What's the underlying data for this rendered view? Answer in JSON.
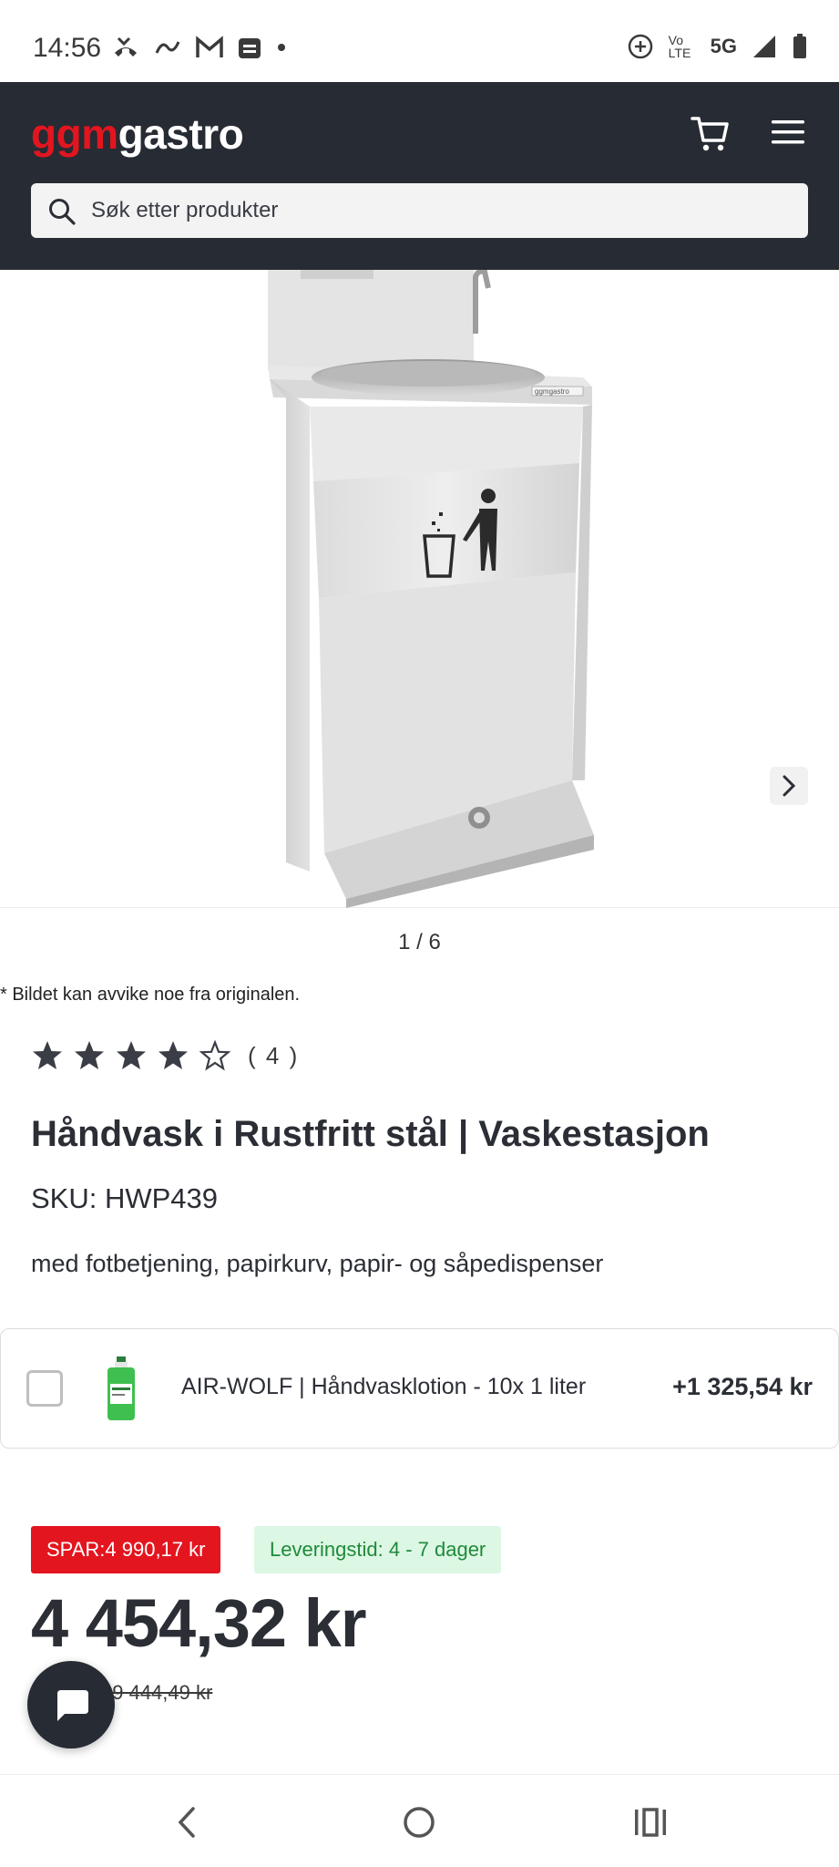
{
  "status_bar": {
    "time": "14:56",
    "left_icons": [
      "missed-call-icon",
      "link-icon",
      "gmail-icon",
      "news-icon",
      "dot-icon"
    ],
    "right_icons": [
      "data-saver-icon",
      "volte-icon",
      "5g-icon",
      "signal-icon",
      "battery-icon"
    ],
    "network_label": "5G",
    "volte_label": "Vo LTE"
  },
  "header": {
    "logo_ggm": "ggm",
    "logo_gastro": "gastro",
    "cart_icon": "cart-icon",
    "menu_icon": "hamburger-menu-icon",
    "search_placeholder": "Søk etter produkter"
  },
  "gallery": {
    "counter": "1 / 6",
    "next_icon": "chevron-right-icon",
    "image_logo": "ggmgastro"
  },
  "disclaimer": "* Bildet kan avvike noe fra originalen.",
  "rating": {
    "value": 4,
    "max": 5,
    "count_label": "( 4 )"
  },
  "product": {
    "title": "Håndvask i Rustfritt stål | Vaskestasjon",
    "sku": "SKU: HWP439",
    "subtitle": "med fotbetjening, papirkurv, papir- og såpedispenser"
  },
  "addon": {
    "name": "AIR-WOLF | Håndvasklotion - 10x 1 liter",
    "price": "+1 325,54 kr",
    "checked": false
  },
  "pricing": {
    "save_label": "SPAR:4 990,17 kr",
    "delivery_label": "Leveringstid: 4 - 7 dager",
    "price": "4 454,32 kr",
    "old_price_prefix": "s: ",
    "old_price": "9 444,49 kr"
  },
  "colors": {
    "brand_red": "#e3151f",
    "header_dark": "#272b33",
    "delivery_green": "#1f8a3b",
    "delivery_bg": "#dcf7e3"
  },
  "nav": {
    "back_icon": "back-chevron-icon",
    "home_icon": "home-circle-icon",
    "recents_icon": "recents-icon"
  },
  "chat": {
    "icon": "chat-bubble-icon"
  }
}
